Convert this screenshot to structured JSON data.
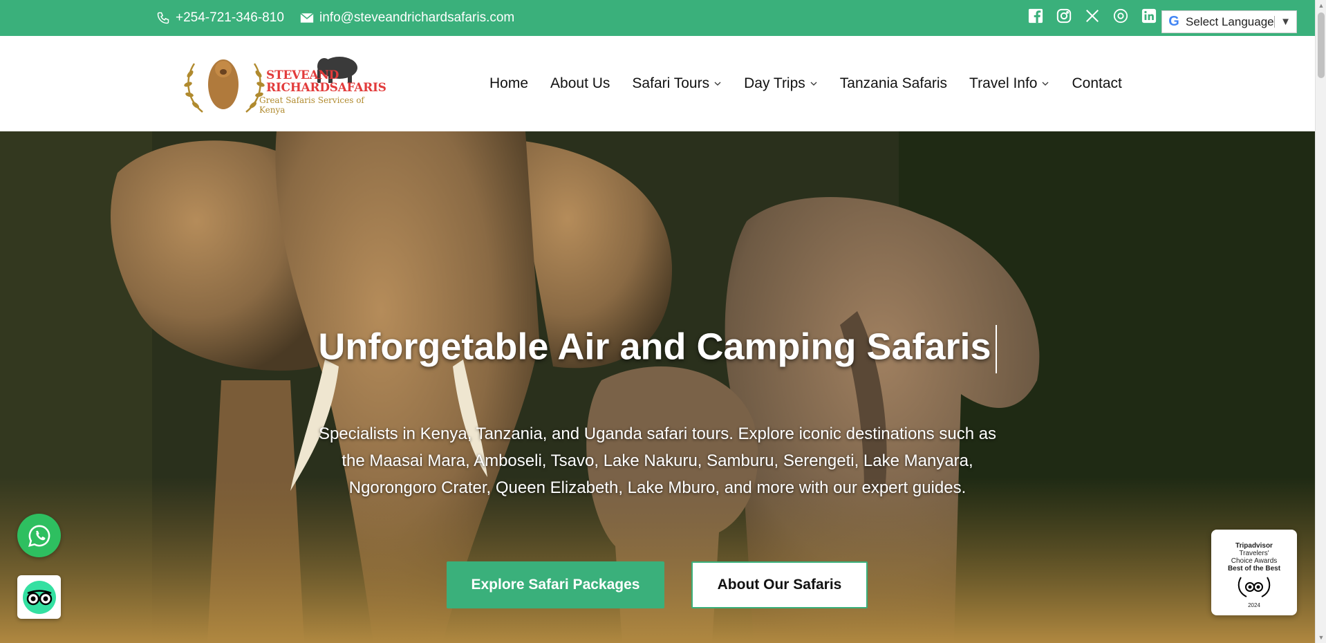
{
  "topbar": {
    "phone": "+254-721-346-810",
    "email": "info@steveandrichardsafaris.com",
    "social_icons": [
      "facebook-icon",
      "instagram-icon",
      "x-icon",
      "threads-icon",
      "linkedin-icon"
    ],
    "language_label": "Select Language",
    "accent_color": "#3ab07b"
  },
  "logo": {
    "line1": "STEVEAND",
    "line2": "RICHARDSAFARIS",
    "tagline": "Great Safaris Services of Kenya"
  },
  "nav": {
    "items": [
      {
        "label": "Home",
        "has_dropdown": false
      },
      {
        "label": "About Us",
        "has_dropdown": false
      },
      {
        "label": "Safari Tours",
        "has_dropdown": true
      },
      {
        "label": "Day Trips",
        "has_dropdown": true
      },
      {
        "label": "Tanzania Safaris",
        "has_dropdown": false
      },
      {
        "label": "Travel Info",
        "has_dropdown": true
      },
      {
        "label": "Contact",
        "has_dropdown": false
      }
    ]
  },
  "hero": {
    "title": "Unforgetable Air and Camping Safaris",
    "subtitle": "Specialists in Kenya, Tanzania, and Uganda safari tours. Explore iconic destinations such as the Maasai Mara, Amboseli, Tsavo, Lake Nakuru, Samburu, Serengeti, Lake Manyara, Ngorongoro Crater, Queen Elizabeth, Lake Mburo, and more with our expert guides.",
    "primary_button": "Explore Safari Packages",
    "secondary_button": "About Our Safaris"
  },
  "tripadvisor_badge": {
    "line1": "Tripadvisor",
    "line2": "Travelers'",
    "line3": "Choice Awards",
    "line4": "Best of the Best",
    "year": "2024"
  }
}
